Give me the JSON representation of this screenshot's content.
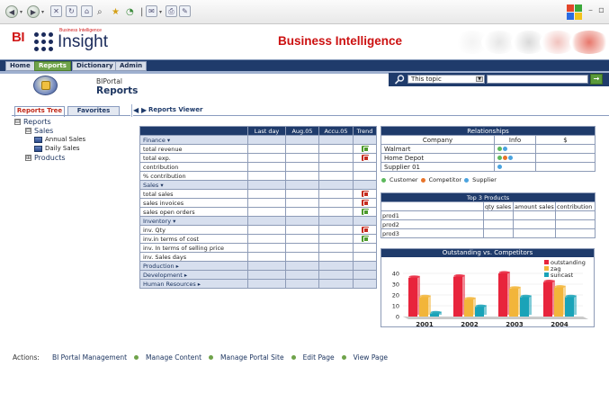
{
  "browser": {
    "buttons": [
      "back-icon",
      "forward-icon",
      "stop-icon",
      "refresh-icon",
      "home-icon",
      "search-icon",
      "favorites-icon",
      "history-icon",
      "mail-icon",
      "print-icon",
      "edit-icon"
    ]
  },
  "header": {
    "logo_bi": "BI",
    "logo_small": "Business Intelligence",
    "logo_main": "Insight",
    "title": "Business Intelligence"
  },
  "nav": {
    "tabs": [
      {
        "label": "Home",
        "active": false
      },
      {
        "label": "Reports",
        "active": true
      },
      {
        "label": "Dictionary",
        "active": false
      },
      {
        "label": "Admin",
        "active": false
      }
    ]
  },
  "portal": {
    "small_title": "BIPortal",
    "big_title": "Reports"
  },
  "search": {
    "topic_value": "This topic",
    "go_label": "→"
  },
  "sidebar": {
    "tabs": [
      {
        "label": "Reports Tree",
        "active": true
      },
      {
        "label": "Favorites",
        "active": false
      }
    ],
    "tree": [
      {
        "label": "Reports",
        "toggle": "⊟",
        "kind": "root"
      },
      {
        "label": "Sales",
        "toggle": "⊟",
        "kind": "folder"
      },
      {
        "label": "Annual Sales",
        "kind": "report"
      },
      {
        "label": "Daily Sales",
        "kind": "report"
      },
      {
        "label": "Products",
        "toggle": "⊞",
        "kind": "folder"
      }
    ]
  },
  "viewer": {
    "arrows": "◀ ▶",
    "title": "Reports Viewer"
  },
  "metrics": {
    "columns": [
      "",
      "Last day",
      "Aug.05",
      "Accu.05",
      "Trend"
    ],
    "rows": [
      {
        "type": "group",
        "label": "Finance ▾"
      },
      {
        "type": "row",
        "label": "total revenue",
        "trend": "up"
      },
      {
        "type": "row",
        "label": "total exp.",
        "trend": "down"
      },
      {
        "type": "row",
        "label": "contribution",
        "trend": ""
      },
      {
        "type": "row",
        "label": "% contribution",
        "trend": ""
      },
      {
        "type": "group",
        "label": "Sales ▾"
      },
      {
        "type": "row",
        "label": "total sales",
        "trend": "down"
      },
      {
        "type": "row",
        "label": "sales invoices",
        "trend": "down"
      },
      {
        "type": "row",
        "label": "sales open orders",
        "trend": "up"
      },
      {
        "type": "group",
        "label": "Inventory ▾"
      },
      {
        "type": "row",
        "label": "inv.  Qty",
        "trend": "down"
      },
      {
        "type": "row",
        "label": "inv.in terms of cost",
        "trend": "up"
      },
      {
        "type": "row",
        "label": "inv. In terms of selling price",
        "trend": ""
      },
      {
        "type": "row",
        "label": "inv. Sales days",
        "trend": ""
      },
      {
        "type": "group",
        "label": "Production ▸"
      },
      {
        "type": "group",
        "label": "Development ▸"
      },
      {
        "type": "group",
        "label": "Human Resources ▸"
      }
    ]
  },
  "relationships": {
    "title": "Relationships",
    "columns": [
      "Company",
      "Info",
      "$"
    ],
    "rows": [
      {
        "company": "Walmart",
        "dots": [
          "#5cb85c",
          "#4aa3df"
        ]
      },
      {
        "company": "Home Depot",
        "dots": [
          "#5cb85c",
          "#e8742a",
          "#4aa3df"
        ]
      },
      {
        "company": "Supplier 01",
        "dots": [
          "#4aa3df"
        ]
      }
    ],
    "legend": [
      {
        "label": "Customer",
        "color": "#5cb85c"
      },
      {
        "label": "Competitor",
        "color": "#e8742a"
      },
      {
        "label": "Supplier",
        "color": "#4aa3df"
      }
    ]
  },
  "top_products": {
    "title": "Top 3 Products",
    "columns": [
      "",
      "qty sales",
      "amount sales",
      "contribution"
    ],
    "rows": [
      "prod1",
      "prod2",
      "prod3"
    ]
  },
  "chart_data": {
    "type": "bar",
    "title": "Outstanding vs. Competitors",
    "categories": [
      "2001",
      "2002",
      "2003",
      "2004"
    ],
    "yticks": [
      0,
      10,
      20,
      30,
      40
    ],
    "ylim": [
      0,
      45
    ],
    "series": [
      {
        "name": "outstanding",
        "color": "#e8243c",
        "values": [
          36,
          37,
          40,
          32
        ]
      },
      {
        "name": "zag",
        "color": "#f2b53a",
        "values": [
          18,
          16,
          26,
          27
        ]
      },
      {
        "name": "suncast",
        "color": "#1aa3b8",
        "values": [
          3,
          9,
          18,
          18
        ]
      }
    ],
    "legend_position": "top-right"
  },
  "actions": {
    "label": "Actions:",
    "links": [
      "BI Portal Management",
      "Manage Content",
      "Manage Portal Site",
      "Edit Page",
      "View Page"
    ]
  }
}
